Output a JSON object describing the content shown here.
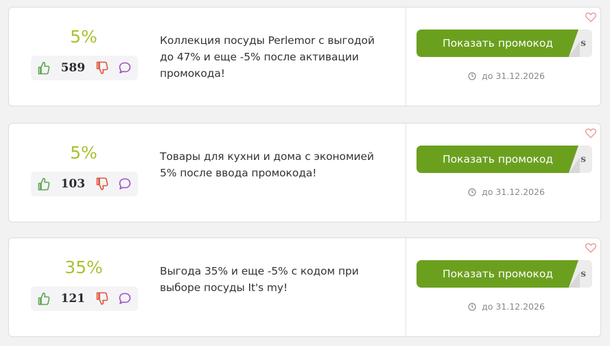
{
  "coupons": [
    {
      "discount": "5%",
      "votes": "589",
      "description": "Коллекция посуды Perlemor с выгодой до 47% и еще -5% после активации промокода!",
      "button_label": "Показать промокод",
      "code_peek": "s",
      "expiry": "до 31.12.2026"
    },
    {
      "discount": "5%",
      "votes": "103",
      "description": "Товары для кухни и дома с экономией 5% после ввода промокода!",
      "button_label": "Показать промокод",
      "code_peek": "s",
      "expiry": "до 31.12.2026"
    },
    {
      "discount": "35%",
      "votes": "121",
      "description": "Выгода 35% и еще -5% с кодом при выборе посуды It's my!",
      "button_label": "Показать промокод",
      "code_peek": "s",
      "expiry": "до 31.12.2026"
    }
  ],
  "icons": {
    "like": "thumbs-up-icon",
    "dislike": "thumbs-down-icon",
    "comment": "comment-icon",
    "clock": "clock-icon",
    "favorite": "heart-icon"
  },
  "colors": {
    "discount": "#a8c232",
    "button": "#6ba01f",
    "like": "#5aa64a",
    "dislike": "#e0503a",
    "comment": "#9b4fc4",
    "heart": "#e69a9a"
  }
}
